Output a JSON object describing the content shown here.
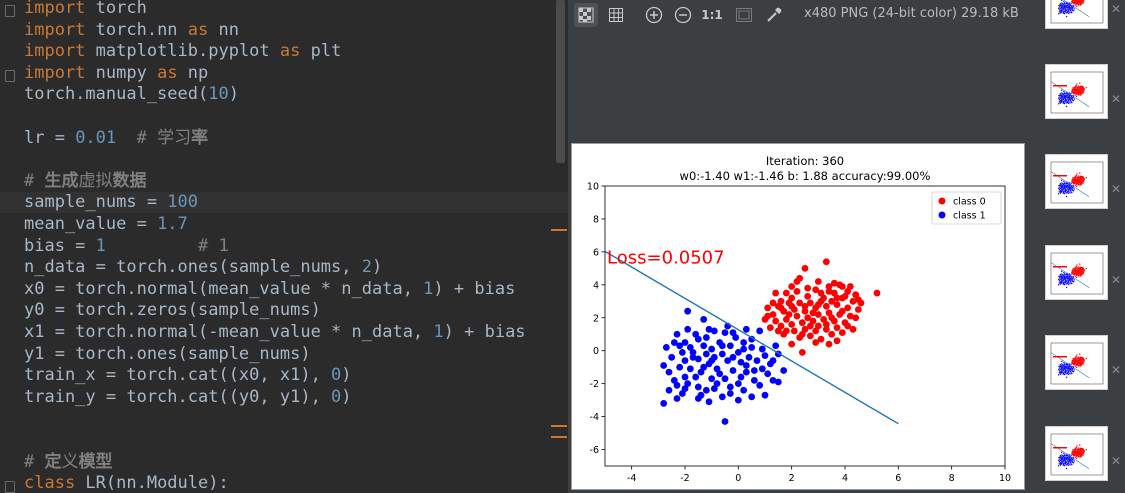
{
  "editor": {
    "lines": [
      [
        {
          "t": "import",
          "c": "kw"
        },
        {
          "t": " torch"
        }
      ],
      [
        {
          "t": "import",
          "c": "kw"
        },
        {
          "t": " torch.nn "
        },
        {
          "t": "as",
          "c": "kw"
        },
        {
          "t": " nn"
        }
      ],
      [
        {
          "t": "import",
          "c": "kw"
        },
        {
          "t": " matplotlib.pyplot "
        },
        {
          "t": "as",
          "c": "kw"
        },
        {
          "t": " plt"
        }
      ],
      [
        {
          "t": "import",
          "c": "kw"
        },
        {
          "t": " numpy "
        },
        {
          "t": "as",
          "c": "kw"
        },
        {
          "t": " np"
        }
      ],
      [
        {
          "t": "torch.manual_seed("
        },
        {
          "t": "10",
          "c": "num"
        },
        {
          "t": ")"
        }
      ],
      [],
      [
        {
          "t": "lr = "
        },
        {
          "t": "0.01",
          "c": "num"
        },
        {
          "t": "  # 学习",
          "c": "cmt"
        },
        {
          "t": "率",
          "c": "cmt",
          "b": true
        }
      ],
      [],
      [
        {
          "t": "# ",
          "c": "cmt"
        },
        {
          "t": "生成",
          "c": "cmt",
          "b": true
        },
        {
          "t": "虚拟",
          "c": "cmt"
        },
        {
          "t": "数据",
          "c": "cmt",
          "b": true
        }
      ],
      [
        {
          "t": "sample_nums = "
        },
        {
          "t": "100",
          "c": "num"
        }
      ],
      [
        {
          "t": "mean_value = "
        },
        {
          "t": "1.7",
          "c": "num"
        }
      ],
      [
        {
          "t": "bias = "
        },
        {
          "t": "1",
          "c": "num"
        },
        {
          "t": "         # 1",
          "c": "cmt"
        }
      ],
      [
        {
          "t": "n_data = torch.ones(sample_nums, "
        },
        {
          "t": "2",
          "c": "num"
        },
        {
          "t": ")"
        }
      ],
      [
        {
          "t": "x0 = torch.normal(mean_value * n_data, "
        },
        {
          "t": "1",
          "c": "num"
        },
        {
          "t": ") + bias"
        }
      ],
      [
        {
          "t": "y0 = torch.zeros(sample_nums)"
        }
      ],
      [
        {
          "t": "x1 = torch.normal(-mean_value * n_data, "
        },
        {
          "t": "1",
          "c": "num"
        },
        {
          "t": ") + bias"
        }
      ],
      [
        {
          "t": "y1 = torch.ones(sample_nums)"
        }
      ],
      [
        {
          "t": "train_x = torch.cat((x0, x1), "
        },
        {
          "t": "0",
          "c": "num"
        },
        {
          "t": ")"
        }
      ],
      [
        {
          "t": "train_y = torch.cat((y0, y1), "
        },
        {
          "t": "0",
          "c": "num"
        },
        {
          "t": ")"
        }
      ],
      [],
      [],
      [
        {
          "t": "# ",
          "c": "cmt"
        },
        {
          "t": "定",
          "c": "cmt",
          "b": true
        },
        {
          "t": "义",
          "c": "cmt"
        },
        {
          "t": "模型",
          "c": "cmt",
          "b": true
        }
      ],
      [
        {
          "t": "class",
          "c": "kw"
        },
        {
          "t": " LR(nn.Module):"
        }
      ]
    ],
    "highlighted_line": 9
  },
  "viewer": {
    "image_info": "x480 PNG (24-bit color) 29.18 kB",
    "toolbar": {
      "zoom_actual_label": "1:1"
    },
    "colors": {
      "accent_marker": "#cc7832"
    }
  },
  "chart_data": {
    "type": "scatter",
    "title": "Iteration: 360",
    "subtitle": "w0:-1.40 w1:-1.46 b: 1.88 accuracy:99.00%",
    "annotation": "Loss=0.0507",
    "xlim": [
      -5,
      10
    ],
    "ylim": [
      -7,
      10
    ],
    "xticks": [
      -4,
      -2,
      0,
      2,
      4,
      6,
      8,
      10
    ],
    "yticks": [
      -6,
      -4,
      -2,
      0,
      2,
      4,
      6,
      8,
      10
    ],
    "legend": "top-right",
    "series": [
      {
        "name": "class 0",
        "color": "#ff0000",
        "points": [
          [
            2.5,
            5.0
          ],
          [
            3.3,
            5.4
          ],
          [
            2.3,
            4.4
          ],
          [
            3.0,
            4.2
          ],
          [
            3.4,
            3.9
          ],
          [
            3.9,
            3.9
          ],
          [
            3.8,
            4.0
          ],
          [
            4.2,
            3.9
          ],
          [
            5.2,
            3.5
          ],
          [
            1.8,
            3.5
          ],
          [
            1.4,
            3.5
          ],
          [
            2.0,
            3.2
          ],
          [
            2.6,
            3.3
          ],
          [
            3.1,
            3.5
          ],
          [
            3.6,
            3.5
          ],
          [
            4.1,
            3.6
          ],
          [
            4.5,
            3.1
          ],
          [
            4.3,
            3.0
          ],
          [
            3.9,
            3.2
          ],
          [
            3.5,
            3.0
          ],
          [
            3.1,
            3.0
          ],
          [
            2.7,
            2.9
          ],
          [
            2.3,
            2.9
          ],
          [
            1.9,
            2.9
          ],
          [
            1.5,
            2.7
          ],
          [
            1.1,
            2.6
          ],
          [
            1.3,
            2.2
          ],
          [
            1.7,
            2.4
          ],
          [
            2.1,
            2.5
          ],
          [
            2.5,
            2.4
          ],
          [
            2.9,
            2.6
          ],
          [
            3.3,
            2.7
          ],
          [
            3.7,
            2.8
          ],
          [
            4.1,
            2.6
          ],
          [
            4.5,
            2.5
          ],
          [
            4.2,
            2.1
          ],
          [
            3.8,
            2.2
          ],
          [
            3.4,
            2.3
          ],
          [
            3.0,
            2.2
          ],
          [
            2.6,
            2.0
          ],
          [
            2.2,
            2.1
          ],
          [
            1.8,
            1.9
          ],
          [
            1.4,
            1.8
          ],
          [
            1.0,
            1.9
          ],
          [
            1.2,
            1.4
          ],
          [
            1.6,
            1.5
          ],
          [
            2.0,
            1.6
          ],
          [
            2.4,
            1.7
          ],
          [
            2.8,
            1.8
          ],
          [
            3.2,
            1.9
          ],
          [
            3.6,
            1.8
          ],
          [
            4.0,
            1.7
          ],
          [
            3.7,
            1.4
          ],
          [
            3.3,
            1.3
          ],
          [
            2.9,
            1.2
          ],
          [
            2.5,
            1.3
          ],
          [
            2.1,
            1.2
          ],
          [
            1.7,
            1.0
          ],
          [
            2.3,
            0.8
          ],
          [
            2.7,
            0.9
          ],
          [
            3.1,
            0.7
          ],
          [
            3.5,
            1.0
          ],
          [
            3.9,
            1.1
          ],
          [
            4.3,
            1.3
          ],
          [
            2.0,
            0.4
          ],
          [
            3.4,
            0.4
          ],
          [
            3.7,
            0.6
          ],
          [
            2.4,
            -0.1
          ],
          [
            1.8,
            1.2
          ],
          [
            2.6,
            3.8
          ],
          [
            3.2,
            3.2
          ],
          [
            4.0,
            3.3
          ],
          [
            2.2,
            3.6
          ],
          [
            1.6,
            3.0
          ],
          [
            2.8,
            2.3
          ],
          [
            3.5,
            2.0
          ],
          [
            4.4,
            2.0
          ],
          [
            1.3,
            2.9
          ],
          [
            2.0,
            2.7
          ],
          [
            3.0,
            1.5
          ],
          [
            2.2,
            4.2
          ],
          [
            3.6,
            4.1
          ],
          [
            2.5,
            2.7
          ],
          [
            3.9,
            2.4
          ],
          [
            1.5,
            1.2
          ],
          [
            4.6,
            2.9
          ],
          [
            2.9,
            3.7
          ],
          [
            3.3,
            1.6
          ],
          [
            1.9,
            2.2
          ],
          [
            4.1,
            1.5
          ],
          [
            3.0,
            2.8
          ],
          [
            2.4,
            1.0
          ],
          [
            1.1,
            2.1
          ],
          [
            3.7,
            3.2
          ],
          [
            2.0,
            3.9
          ],
          [
            4.4,
            3.4
          ],
          [
            2.7,
            1.5
          ],
          [
            3.4,
            3.6
          ],
          [
            1.6,
            2.6
          ],
          [
            2.9,
            0.5
          ]
        ]
      },
      {
        "name": "class 1",
        "color": "#0000ff",
        "points": [
          [
            -1.9,
            2.4
          ],
          [
            -1.3,
            1.9
          ],
          [
            -1.1,
            1.3
          ],
          [
            -1.9,
            1.3
          ],
          [
            -2.3,
            1.0
          ],
          [
            -0.9,
            1.2
          ],
          [
            -0.5,
            1.1
          ],
          [
            -0.2,
            1.1
          ],
          [
            0.3,
            1.3
          ],
          [
            0.8,
            1.2
          ],
          [
            -1.5,
            0.7
          ],
          [
            -2.0,
            0.5
          ],
          [
            -2.4,
            0.5
          ],
          [
            -2.7,
            0.2
          ],
          [
            -1.3,
            0.3
          ],
          [
            -0.7,
            0.5
          ],
          [
            -0.3,
            0.3
          ],
          [
            0.2,
            0.5
          ],
          [
            0.5,
            0.2
          ],
          [
            1.4,
            0.3
          ],
          [
            -2.1,
            -0.1
          ],
          [
            -1.7,
            -0.1
          ],
          [
            -1.2,
            -0.2
          ],
          [
            -0.6,
            -0.2
          ],
          [
            0.0,
            -0.1
          ],
          [
            0.4,
            -0.4
          ],
          [
            1.0,
            -0.3
          ],
          [
            1.5,
            -0.2
          ],
          [
            -2.5,
            -0.4
          ],
          [
            -2.0,
            -0.6
          ],
          [
            -1.5,
            -0.5
          ],
          [
            -1.0,
            -0.6
          ],
          [
            -0.4,
            -0.6
          ],
          [
            0.1,
            -0.7
          ],
          [
            0.7,
            -0.6
          ],
          [
            1.2,
            -0.8
          ],
          [
            -2.2,
            -1.0
          ],
          [
            -1.8,
            -1.1
          ],
          [
            -1.3,
            -1.0
          ],
          [
            -0.8,
            -1.1
          ],
          [
            -0.2,
            -1.2
          ],
          [
            0.3,
            -1.3
          ],
          [
            0.9,
            -1.1
          ],
          [
            -2.0,
            -1.6
          ],
          [
            -1.6,
            -1.6
          ],
          [
            -1.0,
            -1.7
          ],
          [
            -0.5,
            -1.7
          ],
          [
            0.1,
            -1.6
          ],
          [
            0.6,
            -1.8
          ],
          [
            1.3,
            -1.8
          ],
          [
            -2.3,
            -2.1
          ],
          [
            -1.5,
            -2.2
          ],
          [
            -0.9,
            -2.3
          ],
          [
            -0.3,
            -2.2
          ],
          [
            0.2,
            -2.4
          ],
          [
            1.5,
            -1.9
          ],
          [
            -2.1,
            -2.6
          ],
          [
            -1.4,
            -2.7
          ],
          [
            -0.6,
            -2.8
          ],
          [
            0.5,
            -2.8
          ],
          [
            1.0,
            -2.7
          ],
          [
            -2.8,
            -3.2
          ],
          [
            -2.3,
            -2.9
          ],
          [
            -1.1,
            -3.1
          ],
          [
            0.0,
            -3.0
          ],
          [
            -0.5,
            -4.3
          ],
          [
            -1.7,
            -0.4
          ],
          [
            -2.6,
            -1.3
          ],
          [
            -1.2,
            0.8
          ],
          [
            -0.1,
            0.8
          ],
          [
            0.5,
            0.7
          ],
          [
            -1.9,
            -2.0
          ],
          [
            -0.7,
            -1.4
          ],
          [
            0.3,
            -0.9
          ],
          [
            1.1,
            -1.4
          ],
          [
            -1.4,
            -1.3
          ],
          [
            -2.4,
            -1.8
          ],
          [
            -0.3,
            -2.6
          ],
          [
            0.8,
            -2.1
          ],
          [
            -1.0,
            0.1
          ],
          [
            -1.6,
            1.0
          ],
          [
            0.0,
            -2.0
          ],
          [
            -0.9,
            -0.4
          ],
          [
            -2.8,
            -0.9
          ],
          [
            1.3,
            -0.6
          ],
          [
            -0.6,
            0.3
          ],
          [
            -1.8,
            0.2
          ],
          [
            0.6,
            -1.2
          ],
          [
            -1.2,
            -2.4
          ],
          [
            -2.2,
            0.3
          ],
          [
            -0.2,
            -0.4
          ],
          [
            0.9,
            0.1
          ],
          [
            -1.5,
            -2.9
          ],
          [
            -0.8,
            -2.0
          ],
          [
            0.2,
            0.1
          ],
          [
            -2.6,
            -2.4
          ],
          [
            -1.1,
            -0.8
          ],
          [
            1.7,
            -1.2
          ],
          [
            -0.4,
            1.5
          ],
          [
            -2.0,
            -2.3
          ]
        ]
      }
    ],
    "line": {
      "x": [
        -5,
        6
      ],
      "y": [
        6.03,
        -4.43
      ],
      "color": "#1f77b4"
    }
  }
}
